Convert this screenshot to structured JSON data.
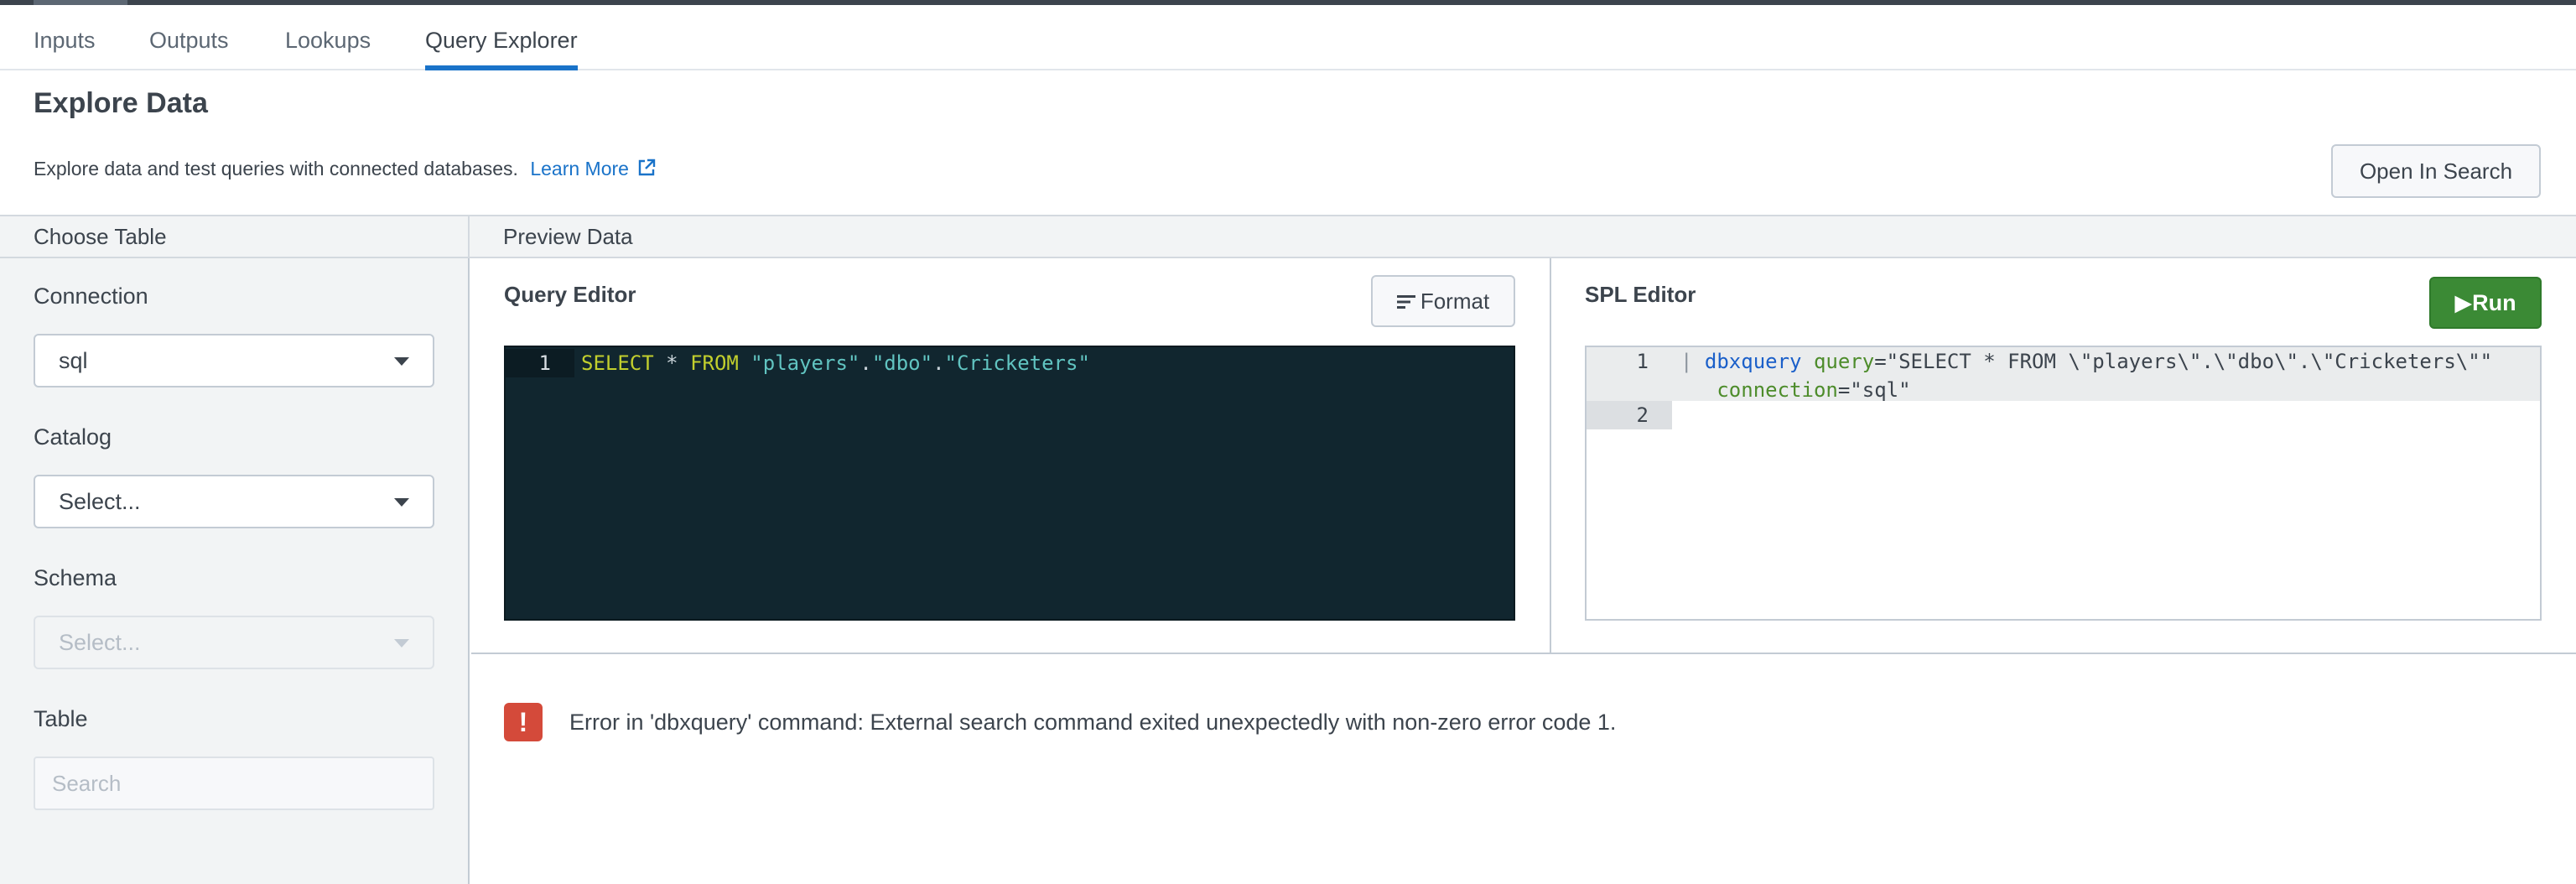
{
  "tabs": [
    {
      "label": "Inputs"
    },
    {
      "label": "Outputs"
    },
    {
      "label": "Lookups"
    },
    {
      "label": "Query Explorer"
    }
  ],
  "page": {
    "title": "Explore Data",
    "description": "Explore data and test queries with connected databases.",
    "learn_more": "Learn More",
    "open_in_search": "Open In Search"
  },
  "sections": {
    "choose_table": "Choose Table",
    "preview_data": "Preview Data"
  },
  "form": {
    "connection": {
      "label": "Connection",
      "value": "sql"
    },
    "catalog": {
      "label": "Catalog",
      "value": "Select..."
    },
    "schema": {
      "label": "Schema",
      "value": "Select..."
    },
    "table": {
      "label": "Table",
      "placeholder": "Search"
    }
  },
  "query_editor": {
    "title": "Query Editor",
    "format_label": "Format",
    "line_number": "1",
    "tokens": {
      "select": "SELECT",
      "star": " * ",
      "from": "FROM",
      "s1": " \"players\"",
      "dot1": ".",
      "s2": "\"dbo\"",
      "dot2": ".",
      "s3": "\"Cricketers\""
    }
  },
  "spl_editor": {
    "title": "SPL Editor",
    "run_label": "Run",
    "line_numbers": [
      "1",
      "2"
    ],
    "tokens": {
      "pipe": "| ",
      "cmd": "dbxquery",
      "arg1": " query",
      "eq1": "=",
      "str1": "\"SELECT * FROM \\\"players\\\".\\\"dbo\\\".\\\"Cricketers\\\"\"",
      "arg2": "   connection",
      "eq2": "=",
      "str2": "\"sql\""
    }
  },
  "error": {
    "icon": "!",
    "message": "Error in 'dbxquery' command: External search command exited unexpectedly with non-zero error code 1."
  },
  "colors": {
    "accent_blue": "#1a73c9",
    "run_green": "#3b8a35",
    "editor_bg": "#11262f",
    "error_red": "#d44a3a"
  }
}
